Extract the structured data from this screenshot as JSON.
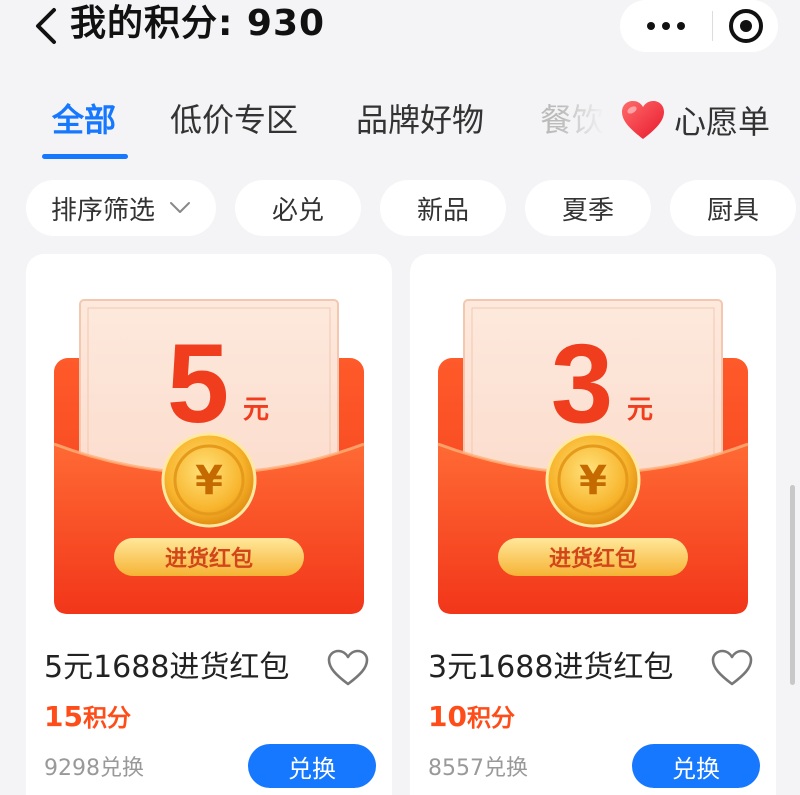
{
  "header": {
    "title": "我的积分: 930"
  },
  "tabs": [
    {
      "label": "全部"
    },
    {
      "label": "低价专区"
    },
    {
      "label": "品牌好物"
    },
    {
      "label": "餐饮"
    },
    {
      "label": "心愿单"
    }
  ],
  "filters": [
    {
      "label": "排序筛选"
    },
    {
      "label": "必兑"
    },
    {
      "label": "新品"
    },
    {
      "label": "夏季"
    },
    {
      "label": "厨具"
    }
  ],
  "products": [
    {
      "title": "5元1688进货红包",
      "points_value": "15",
      "points_unit": "积分",
      "sold": "9298兑换",
      "button": "兑换",
      "envelope": {
        "amount": "5",
        "unit": "元",
        "coin": "¥",
        "band": "进货红包"
      }
    },
    {
      "title": "3元1688进货红包",
      "points_value": "10",
      "points_unit": "积分",
      "sold": "8557兑换",
      "button": "兑换",
      "envelope": {
        "amount": "3",
        "unit": "元",
        "coin": "¥",
        "band": "进货红包"
      }
    }
  ],
  "colors": {
    "accent": "#1677ff",
    "points": "#ff4d1a",
    "envelope_red": "#f5391c",
    "gold": "#f7b531"
  },
  "icons": {
    "back": "chevron-left-icon",
    "more": "more-dots-icon",
    "close": "close-circle-icon",
    "wish": "heart-icon",
    "sort": "chevron-down-icon",
    "favorite": "heart-outline-icon"
  }
}
